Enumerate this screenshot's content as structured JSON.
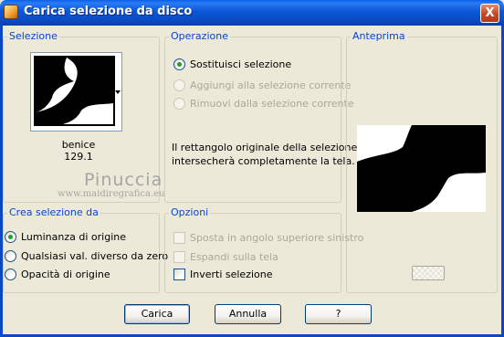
{
  "window": {
    "title": "Carica selezione da disco",
    "close_label": "X"
  },
  "selezione": {
    "group_label": "Selezione",
    "file_name": "benice 129.1"
  },
  "operazione": {
    "group_label": "Operazione",
    "options": [
      {
        "label": "Sostituisci selezione",
        "selected": true,
        "enabled": true
      },
      {
        "label": "Aggiungi alla selezione corrente",
        "selected": false,
        "enabled": false
      },
      {
        "label": "Rimuovi dalla selezione corrente",
        "selected": false,
        "enabled": false
      }
    ],
    "description_line1": "Il rettangolo originale della selezione",
    "description_line2": "intersecherà completamente la tela."
  },
  "anteprima": {
    "group_label": "Anteprima"
  },
  "crea": {
    "group_label": "Crea selezione da",
    "options": [
      {
        "label": "Luminanza di origine",
        "selected": true
      },
      {
        "label": "Qualsiasi val. diverso da zero",
        "selected": false
      },
      {
        "label": "Opacità di origine",
        "selected": false
      }
    ]
  },
  "opzioni": {
    "group_label": "Opzioni",
    "options": [
      {
        "label": "Sposta in angolo superiore sinistro",
        "checked": false,
        "enabled": false
      },
      {
        "label": "Espandi sulla tela",
        "checked": false,
        "enabled": false
      },
      {
        "label": "Inverti selezione",
        "checked": false,
        "enabled": true
      }
    ]
  },
  "watermark": {
    "line1": "Pinuccia",
    "line2": "www.maidiregrafica.eu"
  },
  "buttons": {
    "load": "Carica",
    "cancel": "Annulla",
    "help": "?"
  },
  "colors": {
    "title_bar": "#0b56d6",
    "group_title": "#0046d5",
    "dialog_bg": "#ece9d8"
  }
}
